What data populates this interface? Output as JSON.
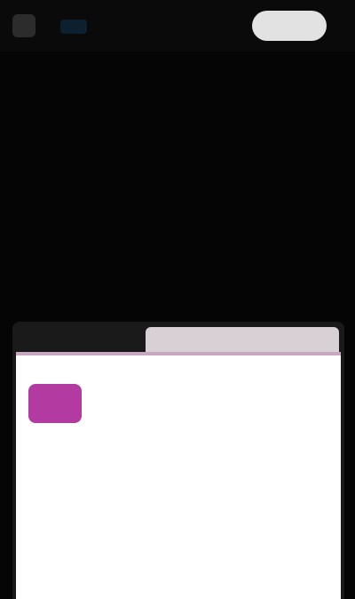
{
  "header": {
    "logo_icon": "site-logo-icon",
    "brand": "",
    "action_button": ""
  },
  "article": {
    "paragraphs": [
      "",
      "",
      "",
      "",
      "",
      "",
      "",
      "",
      "",
      "",
      ""
    ]
  },
  "consent": {
    "logo_text": "",
    "title": "",
    "description": "",
    "link_primary": "",
    "link_secondary": "",
    "body": "",
    "footer": "",
    "footer_link": ""
  },
  "colors": {
    "background": "#050505",
    "accent": "#b23aa0",
    "button": "#e2e2e2"
  }
}
